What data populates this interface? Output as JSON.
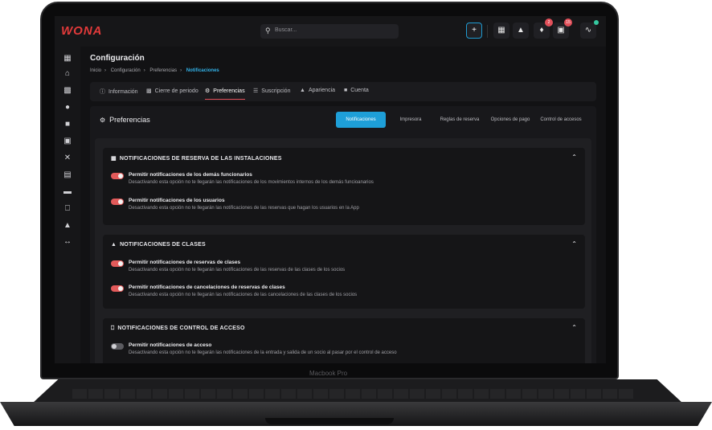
{
  "device": {
    "label": "Macbook Pro"
  },
  "topbar": {
    "logo": "WONA",
    "search_placeholder": "Buscar...",
    "notifications_badge": "2",
    "contacts_badge": "15"
  },
  "page": {
    "title": "Configuración",
    "breadcrumb": [
      "Inicio",
      "Configuración",
      "Preferencias",
      "Notificaciones"
    ]
  },
  "tabs": [
    {
      "label": "Información",
      "icon": "info-icon"
    },
    {
      "label": "Cierre de periodo",
      "icon": "calendar-icon"
    },
    {
      "label": "Preferencias",
      "icon": "gears-icon"
    },
    {
      "label": "Suscripción",
      "icon": "layers-icon"
    },
    {
      "label": "Apariencia",
      "icon": "paint-roller-icon"
    },
    {
      "label": "Cuenta",
      "icon": "lock-icon"
    }
  ],
  "preferences": {
    "title": "Preferencias",
    "subtabs": [
      "Notificaciones",
      "Impresora",
      "Reglas de reserva",
      "Opciones de pago",
      "Control de accesos"
    ],
    "active_subtab": "Notificaciones"
  },
  "sections": [
    {
      "title": "NOTIFICACIONES DE RESERVA DE LAS INSTALACIONES",
      "options": [
        {
          "label": "Permitir notificaciones de los demás funcionarios",
          "desc": "Desactivando esta opción no te llegarán las notificaciones de los movimientos internos  de los demás funcioanarios",
          "enabled": true
        },
        {
          "label": "Permitir notificaciones de los usuarios",
          "desc": "Desactivando esta opción no te llegarán las notificaciones de las reservas que hagan los usuarios en la App",
          "enabled": true
        }
      ]
    },
    {
      "title": "NOTIFICACIONES DE CLASES",
      "options": [
        {
          "label": "Permitir notificaciones de reservas de clases",
          "desc": "Desactivando esta opción no te llegarán las notificaciones de las reservas de las clases de los socios",
          "enabled": true
        },
        {
          "label": "Permitir notificaciones de cancelaciones de reservas de clases",
          "desc": "Desactivando esta opción no te llegarán las notificaciones de las cancelaciones de las clases de los socios",
          "enabled": true
        }
      ]
    },
    {
      "title": "NOTIFICACIONES DE CONTROL DE ACCESO",
      "options": [
        {
          "label": "Permitir notificaciones de acceso",
          "desc": "Desactivando esta opción no te llegarán las notificaciones de la entrada y salida de un socio al pasar por el control de acceso",
          "enabled": false
        }
      ]
    }
  ],
  "colors": {
    "accent": "#1e9fd8",
    "brand": "#e23a3a",
    "toggle_on": "#e25a5a"
  }
}
